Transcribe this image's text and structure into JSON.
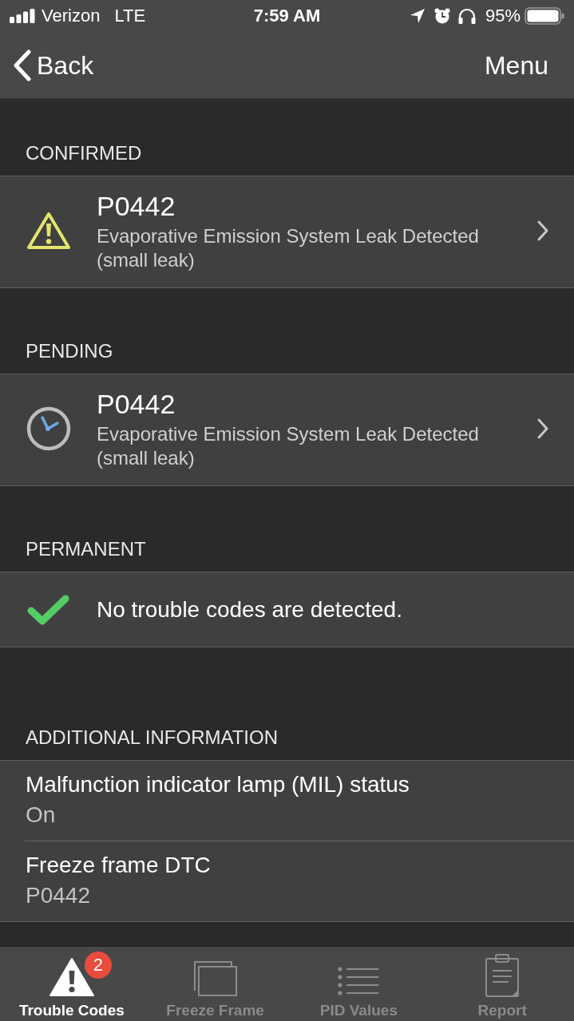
{
  "status_bar": {
    "carrier": "Verizon",
    "network": "LTE",
    "time": "7:59 AM",
    "battery": "95%"
  },
  "nav_bar": {
    "back": "Back",
    "menu": "Menu"
  },
  "sections": [
    {
      "kind": "confirmed",
      "title": "CONFIRMED",
      "items": [
        {
          "kind": "code",
          "code": "P0442",
          "description": "Evaporative Emission System Leak Detected (small leak)"
        }
      ]
    },
    {
      "kind": "pending",
      "title": "PENDING",
      "items": [
        {
          "kind": "code",
          "code": "P0442",
          "description": "Evaporative Emission System Leak Detected (small leak)"
        }
      ]
    },
    {
      "kind": "permanent",
      "title": "PERMANENT",
      "items": [
        {
          "kind": "message",
          "text": "No trouble codes are detected."
        }
      ]
    }
  ],
  "additional_information": {
    "title": "ADDITIONAL INFORMATION",
    "rows": [
      {
        "label": "Malfunction indicator lamp (MIL) status",
        "value": "On"
      },
      {
        "label": "Freeze frame DTC",
        "value": "P0442"
      }
    ]
  },
  "tabs": [
    {
      "kind": "trouble_codes",
      "label": "Trouble Codes",
      "selected": true,
      "badge": "2"
    },
    {
      "kind": "freeze_frame",
      "label": "Freeze Frame",
      "selected": false
    },
    {
      "kind": "pid_values",
      "label": "PID Values",
      "selected": false
    },
    {
      "kind": "report",
      "label": "Report",
      "selected": false
    }
  ]
}
